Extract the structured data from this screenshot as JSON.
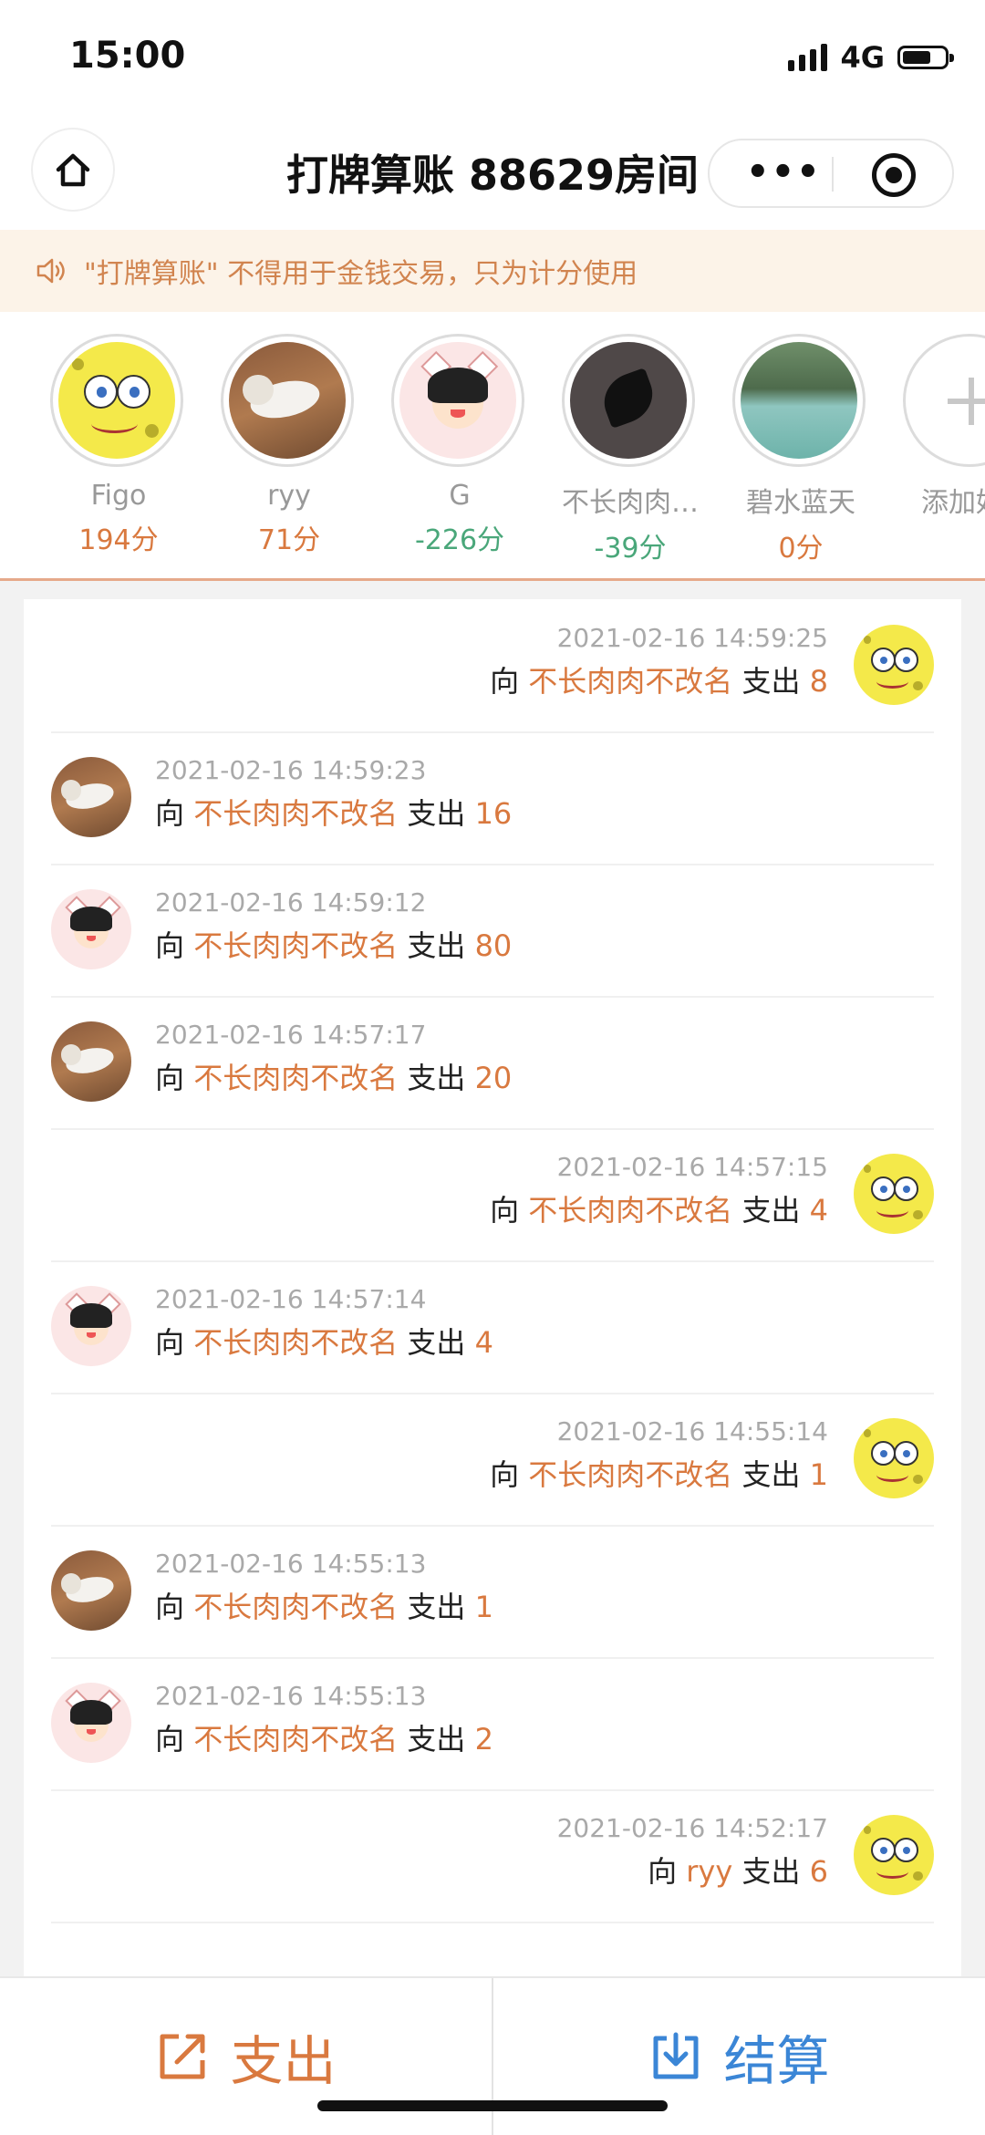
{
  "status_bar": {
    "time": "15:00",
    "network": "4G"
  },
  "nav": {
    "title": "打牌算账 88629房间",
    "more_icon": "more-dots-icon",
    "close_icon": "target-icon",
    "home_icon": "home-icon"
  },
  "notice": {
    "text": "\"打牌算账\" 不得用于金钱交易，只为计分使用",
    "icon": "speaker-icon"
  },
  "players": [
    {
      "name": "Figo",
      "score": "194分",
      "avatar": "sponge",
      "tone": "pos"
    },
    {
      "name": "ryy",
      "score": "71分",
      "avatar": "cat",
      "tone": "pos"
    },
    {
      "name": "G",
      "score": "-226分",
      "avatar": "girl",
      "tone": "neg"
    },
    {
      "name": "不长肉肉…",
      "score": "-39分",
      "avatar": "leaf",
      "tone": "neg"
    },
    {
      "name": "碧水蓝天",
      "score": "0分",
      "avatar": "lake",
      "tone": "pos"
    }
  ],
  "add_player": {
    "label": "添加好",
    "icon": "plus-icon"
  },
  "records": [
    {
      "side": "right",
      "avatar": "sponge",
      "time": "2021-02-16 14:59:25",
      "prefix": "向",
      "target": "不长肉肉不改名",
      "action": "支出",
      "amount": "8"
    },
    {
      "side": "left",
      "avatar": "cat",
      "time": "2021-02-16 14:59:23",
      "prefix": "向",
      "target": "不长肉肉不改名",
      "action": "支出",
      "amount": "16"
    },
    {
      "side": "left",
      "avatar": "girl",
      "time": "2021-02-16 14:59:12",
      "prefix": "向",
      "target": "不长肉肉不改名",
      "action": "支出",
      "amount": "80"
    },
    {
      "side": "left",
      "avatar": "cat",
      "time": "2021-02-16 14:57:17",
      "prefix": "向",
      "target": "不长肉肉不改名",
      "action": "支出",
      "amount": "20"
    },
    {
      "side": "right",
      "avatar": "sponge",
      "time": "2021-02-16 14:57:15",
      "prefix": "向",
      "target": "不长肉肉不改名",
      "action": "支出",
      "amount": "4"
    },
    {
      "side": "left",
      "avatar": "girl",
      "time": "2021-02-16 14:57:14",
      "prefix": "向",
      "target": "不长肉肉不改名",
      "action": "支出",
      "amount": "4"
    },
    {
      "side": "right",
      "avatar": "sponge",
      "time": "2021-02-16 14:55:14",
      "prefix": "向",
      "target": "不长肉肉不改名",
      "action": "支出",
      "amount": "1"
    },
    {
      "side": "left",
      "avatar": "cat",
      "time": "2021-02-16 14:55:13",
      "prefix": "向",
      "target": "不长肉肉不改名",
      "action": "支出",
      "amount": "1"
    },
    {
      "side": "left",
      "avatar": "girl",
      "time": "2021-02-16 14:55:13",
      "prefix": "向",
      "target": "不长肉肉不改名",
      "action": "支出",
      "amount": "2"
    },
    {
      "side": "right",
      "avatar": "sponge",
      "time": "2021-02-16 14:52:17",
      "prefix": "向",
      "target": "ryy",
      "action": "支出",
      "amount": "6"
    }
  ],
  "bottom": {
    "pay": {
      "label": "支出",
      "icon": "share-out-icon",
      "color": "#d9793f"
    },
    "settle": {
      "label": "结算",
      "icon": "download-icon",
      "color": "#3b86d6"
    }
  }
}
